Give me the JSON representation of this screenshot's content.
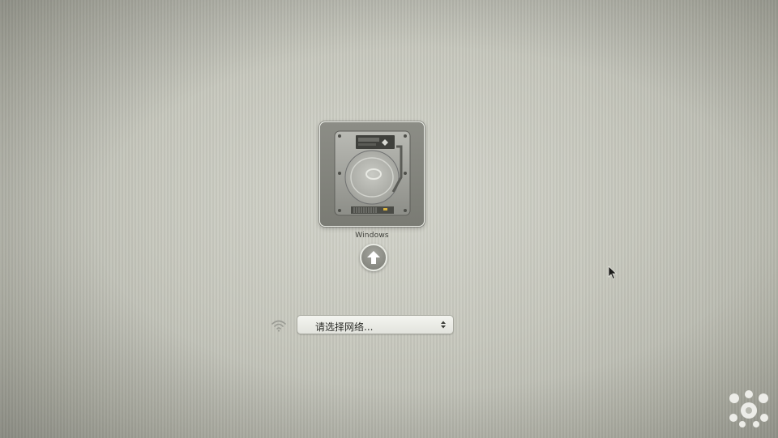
{
  "startup": {
    "disk": {
      "label": "Windows",
      "icon": "hard-drive-icon",
      "selected": true
    },
    "boot_arrow_icon": "up-arrow-icon"
  },
  "network": {
    "wifi_icon": "wifi-icon",
    "selected_label": "请选择网络...",
    "dropdown_icon": "updown-arrows-icon"
  },
  "overlay": {
    "cursor_icon": "mouse-pointer-icon",
    "watermark_icon": "watermark-logo-icon"
  },
  "colors": {
    "background": "#c6c7bd",
    "tile": "#7a7b74",
    "tile_border": "#eef0ea",
    "select_bg": "#e9eae4"
  }
}
